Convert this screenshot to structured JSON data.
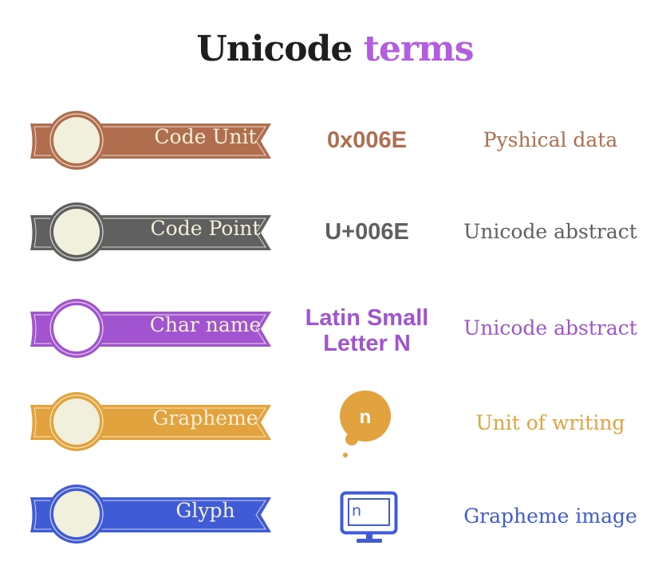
{
  "title": {
    "main": "Unicode",
    "accent": "terms",
    "main_color": "#1e1e1e",
    "accent_color": "#b35ee0"
  },
  "rows": [
    {
      "term": "Code Unit",
      "value": "0x006E",
      "value_type": "text",
      "description": "Pyshical data",
      "color": "#b06e4f",
      "circle_fill": "#f1f0dc"
    },
    {
      "term": "Code Point",
      "value": "U+006E",
      "value_type": "text",
      "description": "Unicode abstract",
      "color": "#606060",
      "circle_fill": "#f1f0dc"
    },
    {
      "term": "Char name",
      "value": "Latin Small Letter N",
      "value_line1": "Latin Small",
      "value_line2": "Letter N",
      "value_type": "text",
      "description": "Unicode abstract",
      "color": "#a253cf",
      "circle_fill": "#ffffff"
    },
    {
      "term": "Grapheme",
      "value": "n",
      "value_type": "thought-bubble-icon",
      "description": "Unit of writing",
      "color": "#e2a23d",
      "circle_fill": "#f1f0dc"
    },
    {
      "term": "Glyph",
      "value": "n",
      "value_type": "monitor-icon",
      "description": "Grapheme image",
      "color": "#3f5bd6",
      "circle_fill": "#f1f0dc"
    }
  ]
}
